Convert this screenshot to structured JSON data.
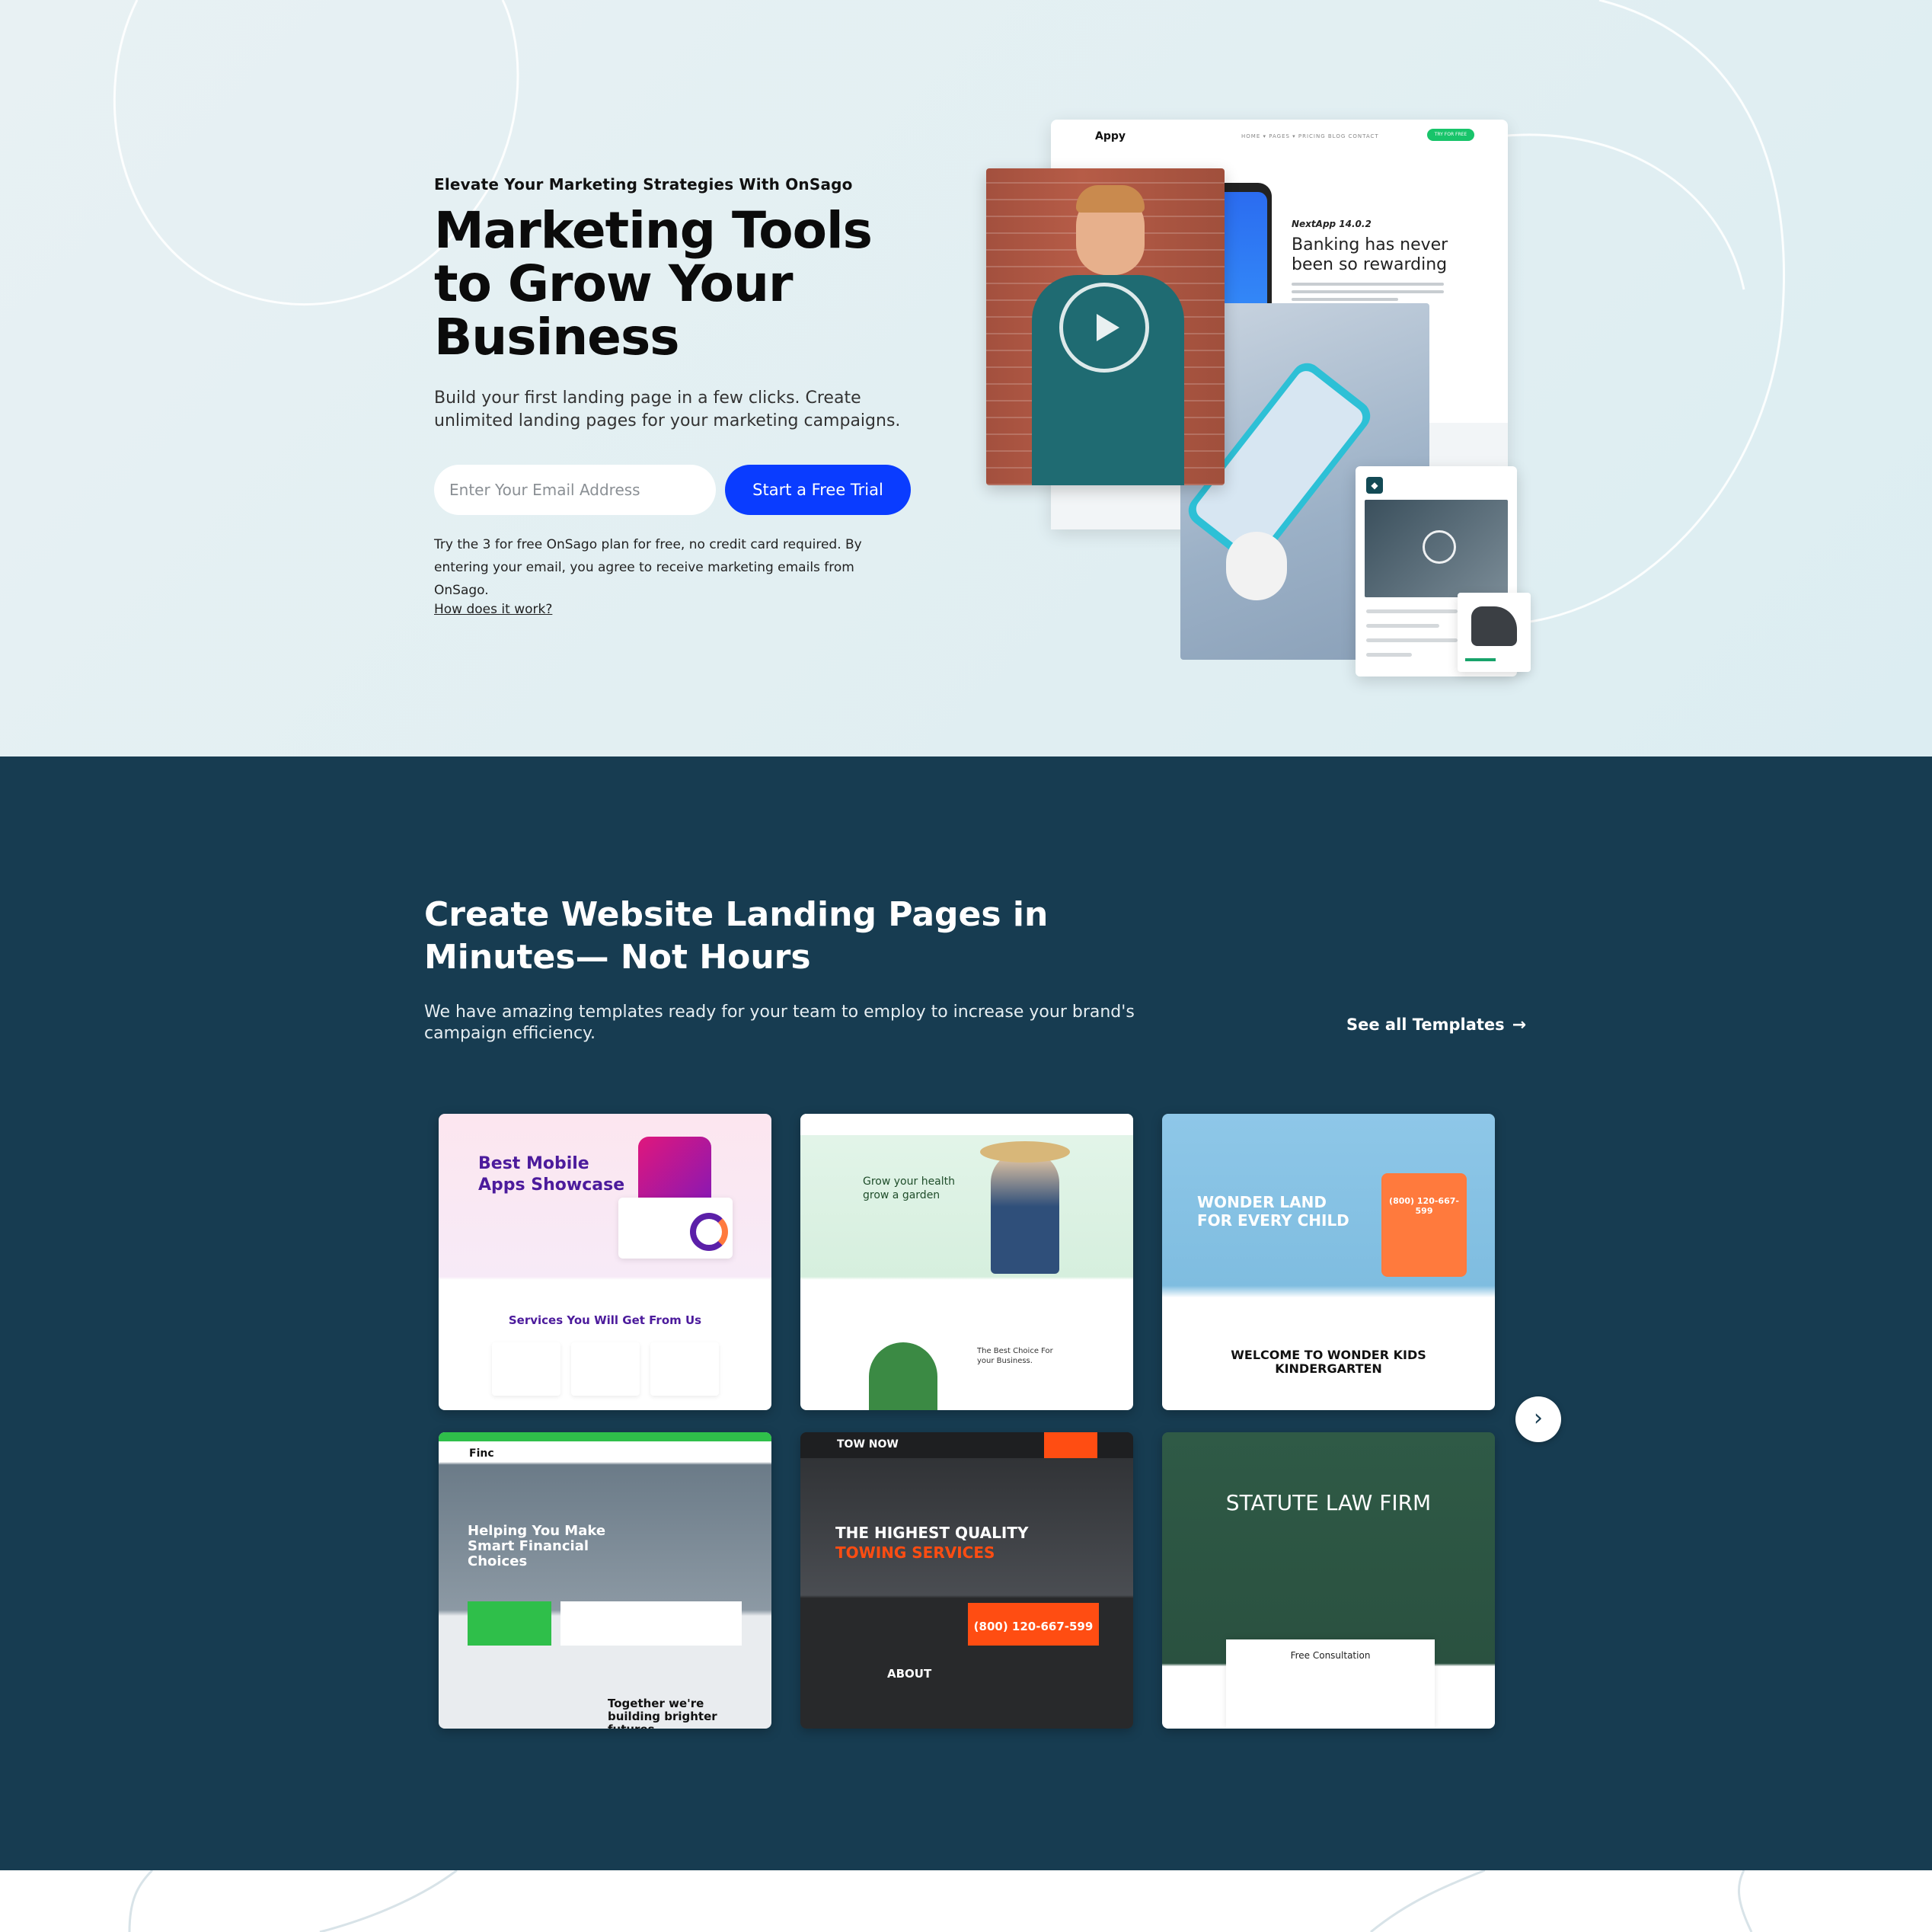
{
  "hero": {
    "eyebrow": "Elevate Your Marketing Strategies With OnSago",
    "title": "Marketing Tools to Grow Your Business",
    "subtitle": "Build your first landing page in a few clicks. Create unlimited landing pages for your marketing campaigns.",
    "email_placeholder": "Enter Your Email Address",
    "cta_label": "Start a Free Trial",
    "legal": "Try the 3 for free OnSago plan for free, no credit card required. By entering your email, you agree to receive marketing emails from OnSago.",
    "how_link": "How does it work?",
    "mockup": {
      "logo": "Appy",
      "nav": "HOME ▾   PAGES ▾   PRICING   BLOG   CONTACT",
      "nav_btn": "TRY FOR FREE",
      "version": "NextApp 14.0.2",
      "headline": "Banking has never been so rewarding"
    }
  },
  "templates": {
    "title": "Create Website Landing Pages in Minutes— Not Hours",
    "description": "We have amazing templates ready for your team to employ to increase your brand's campaign efficiency.",
    "see_all": "See all Templates",
    "items": [
      {
        "heading": "Best Mobile Apps Showcase",
        "sub": "Services You Will Get From Us",
        "bg": "#fbe7ef",
        "accent": "#5b1fa8"
      },
      {
        "heading": "Grow your health grow a garden",
        "sub": "The Best Choice For your Business.",
        "bg": "#e3f4ea",
        "accent": "#2e8b3d"
      },
      {
        "heading": "WONDER LAND FOR EVERY CHILD",
        "sub": "WELCOME TO WONDER KIDS KINDERGARTEN",
        "phone": "(800) 120-667-599",
        "bg": "#8ec7e8",
        "accent": "#ff7a3d"
      },
      {
        "heading": "Helping You Make Smart Financial Choices",
        "sub": "Together we're building brighter futures",
        "brand": "Finc",
        "bg": "#5b6b78",
        "accent": "#2fbf4a"
      },
      {
        "heading": "THE HIGHEST QUALITY",
        "heading2": "TOWING SERVICES",
        "brand": "TOW NOW",
        "phone": "(800) 120-667-599",
        "sub": "ABOUT",
        "bg": "#2a2b2d",
        "accent": "#ff4d12"
      },
      {
        "heading": "STATUTE LAW FIRM",
        "sub": "Free Consultation",
        "bg": "#2e5744",
        "accent": "#ffffff"
      }
    ]
  }
}
